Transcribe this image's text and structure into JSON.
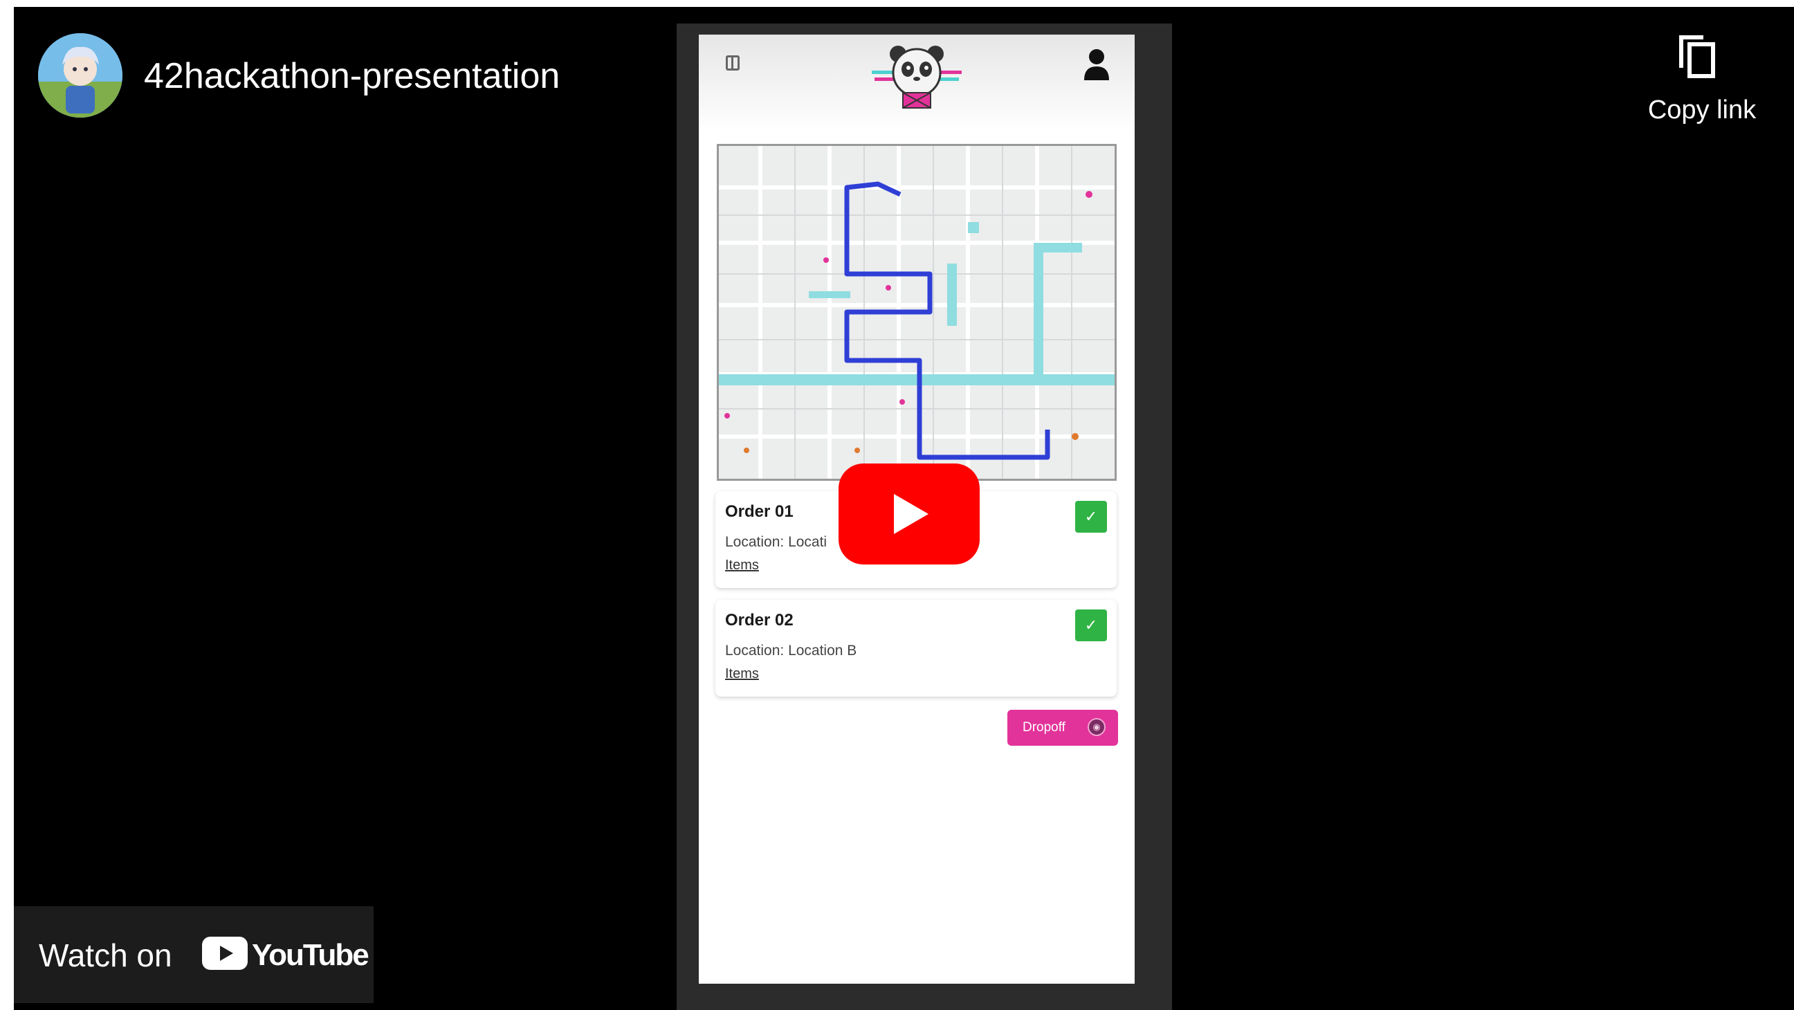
{
  "player": {
    "channel_title": "42hackathon-presentation",
    "copy_link_label": "Copy link",
    "watch_on_label": "Watch on",
    "youtube_wordmark": "YouTube",
    "play_icon": "play-icon"
  },
  "app": {
    "orders": [
      {
        "title": "Order 01",
        "location": "Location: Locati",
        "items_label": "Items",
        "done": true
      },
      {
        "title": "Order 02",
        "location": "Location: Location B",
        "items_label": "Items",
        "done": true
      }
    ],
    "dropoff_label": "Dropoff",
    "check_glyph": "✓"
  },
  "colors": {
    "accent_pink": "#e2339a",
    "check_green": "#2fb344",
    "route_blue": "#2f3fd6",
    "youtube_red": "#ff0000"
  }
}
